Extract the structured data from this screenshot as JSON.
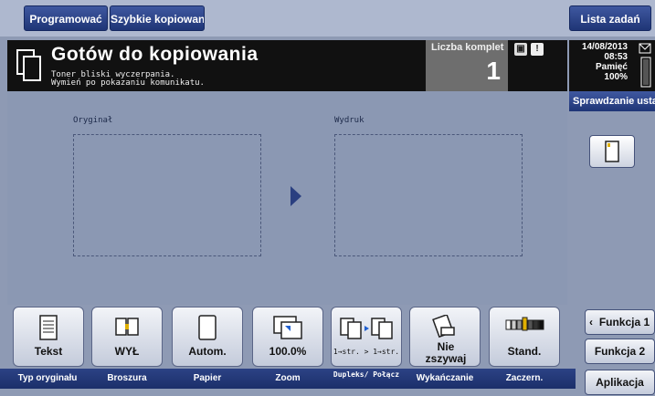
{
  "topbar": {
    "programowac_label": "Programować",
    "szybkie_label": "Szybkie kopiowani",
    "lista_label": "Lista zadań"
  },
  "status": {
    "title": "Gotów do kopiowania",
    "msg_line1": "Toner bliski wyczerpania.",
    "msg_line2": "Wymień po pokazaniu komunikatu.",
    "liczba_label": "Liczba komplet",
    "liczba_value": "1"
  },
  "info": {
    "date": "14/08/2013",
    "time": "08:53",
    "memory_label": "Pamięć",
    "memory_value": "100%",
    "check_label": "Sprawdzanie usta"
  },
  "main": {
    "original_label": "Oryginał",
    "output_label": "Wydruk"
  },
  "functions": [
    {
      "value": "Tekst",
      "label": "Typ oryginału"
    },
    {
      "value": "WYŁ",
      "label": "Broszura"
    },
    {
      "value": "Autom.",
      "label": "Papier"
    },
    {
      "value": "100.0%",
      "label": "Zoom"
    },
    {
      "value": "1→str. > 1→str.",
      "label": "Dupleks/ Połącz"
    },
    {
      "value": "Nie zszywaj",
      "label": "Wykańczanie"
    },
    {
      "value": "Stand.",
      "label": "Zaczern."
    }
  ],
  "right_buttons": {
    "funkcja1": "Funkcja 1",
    "funkcja2": "Funkcja 2",
    "aplikacja": "Aplikacja"
  },
  "colors": {
    "accent": "#1f3576",
    "background": "#8e9ab4"
  }
}
